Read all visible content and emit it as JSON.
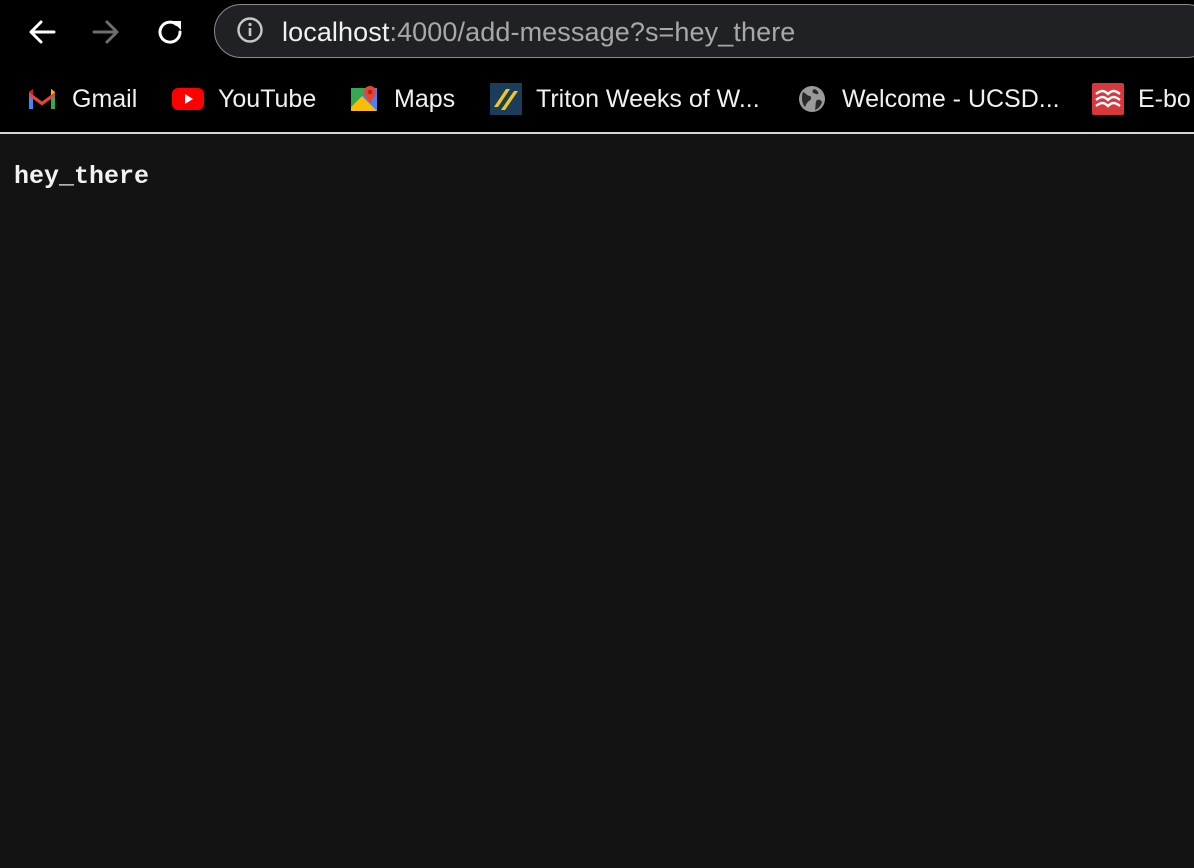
{
  "browser": {
    "nav": {
      "back_icon": "arrow-left-icon",
      "forward_icon": "arrow-right-icon",
      "reload_icon": "reload-icon"
    },
    "address_bar": {
      "site_info_icon": "info-icon",
      "host": "localhost",
      "path": ":4000/add-message?s=hey_there"
    },
    "bookmarks": [
      {
        "label": "Gmail",
        "icon": "gmail-icon"
      },
      {
        "label": "YouTube",
        "icon": "youtube-icon"
      },
      {
        "label": "Maps",
        "icon": "maps-icon"
      },
      {
        "label": "Triton Weeks of W...",
        "icon": "triton-icon"
      },
      {
        "label": "Welcome - UCSD...",
        "icon": "globe-icon"
      },
      {
        "label": "E-bo",
        "icon": "ebook-icon"
      }
    ]
  },
  "page": {
    "message": "hey_there"
  },
  "colors": {
    "chrome_bg": "#000000",
    "page_bg": "#131313",
    "text": "#f1f1f1",
    "url_path": "#a8a8a8",
    "youtube_red": "#ff0000"
  }
}
